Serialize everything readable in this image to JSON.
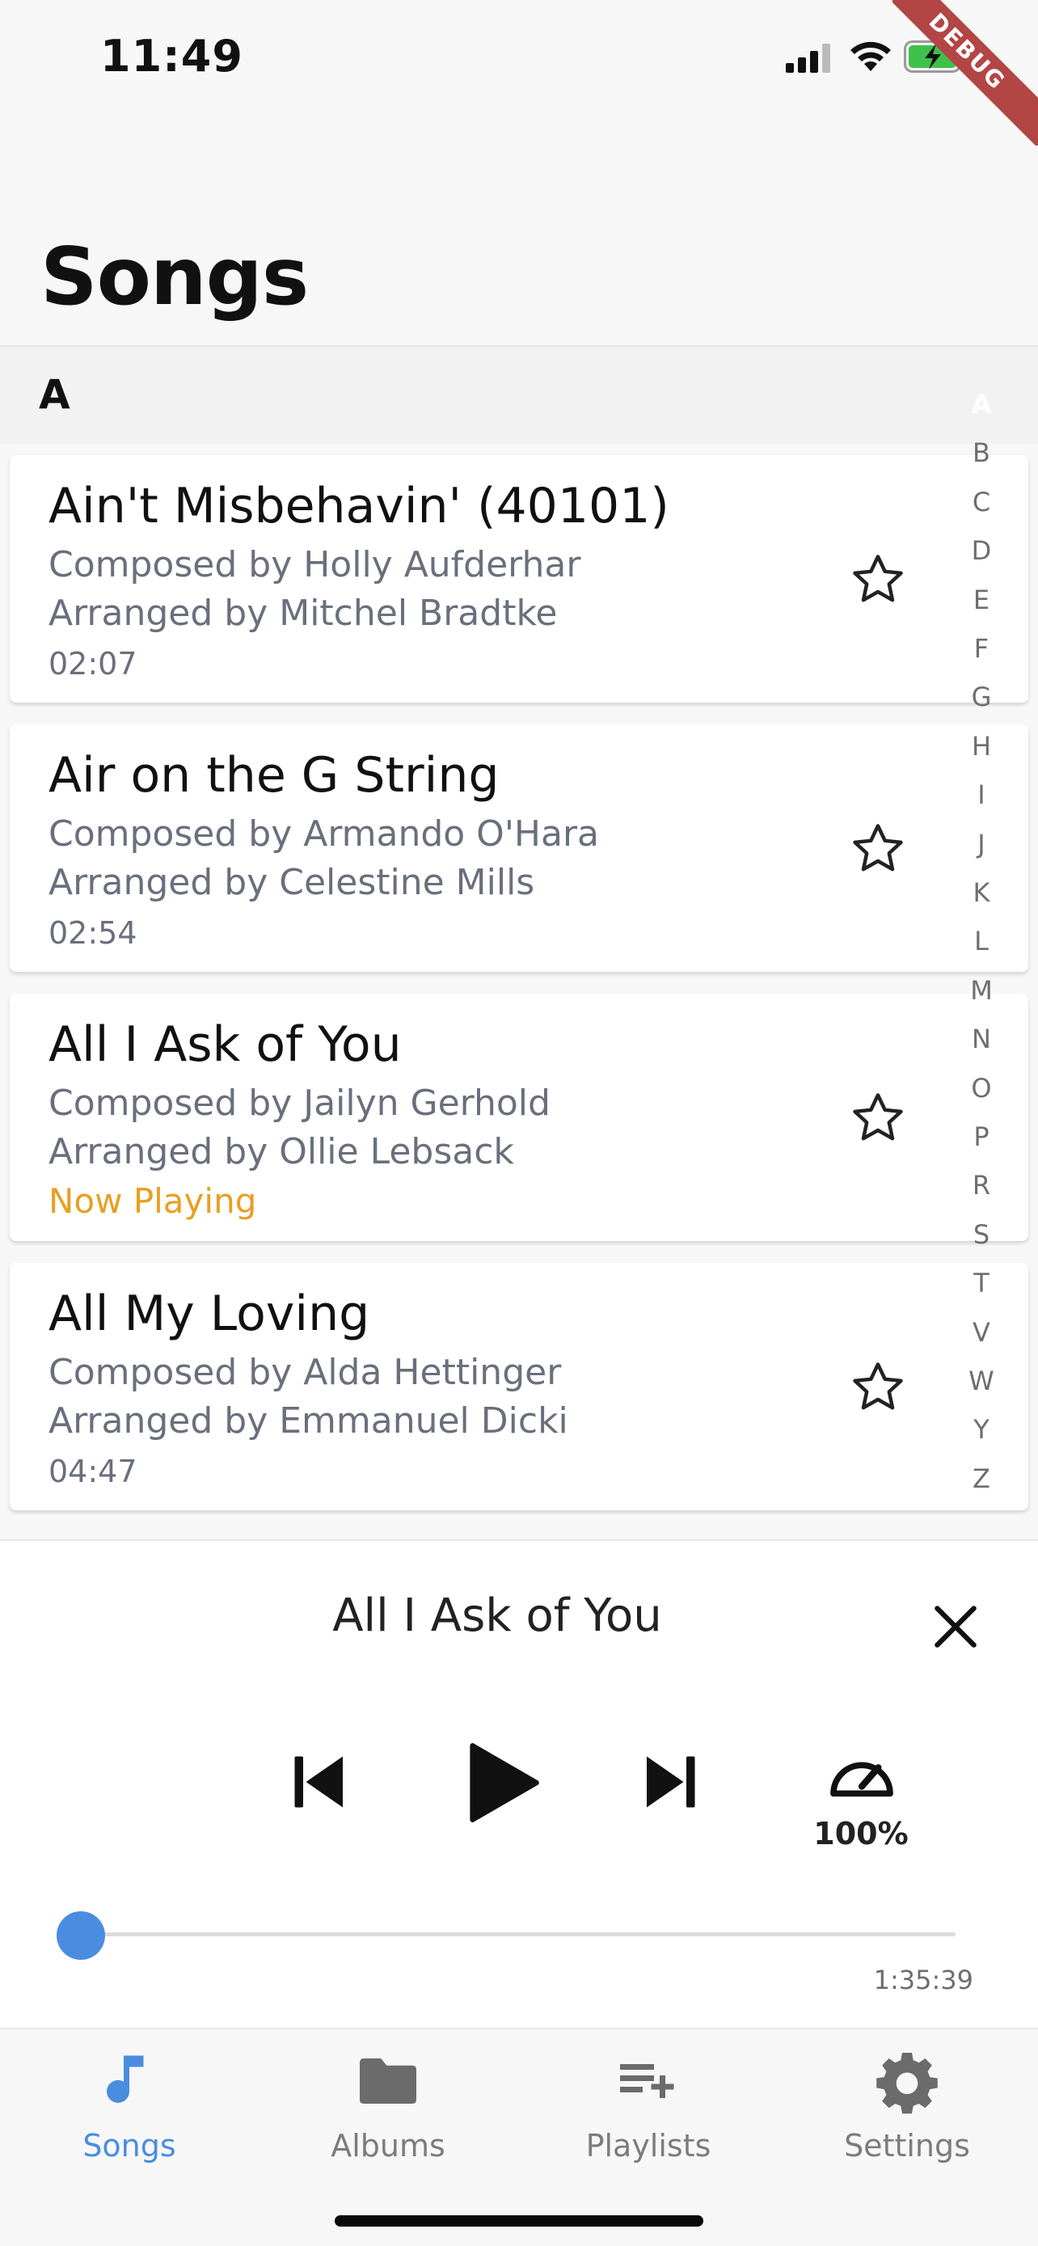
{
  "status_bar": {
    "time": "11:49",
    "debug_banner": "DEBUG",
    "icons": [
      "signal-icon",
      "wifi-icon",
      "battery-charging-icon"
    ],
    "battery_color": "#3ec14a"
  },
  "page": {
    "title": "Songs"
  },
  "section": {
    "letter": "A"
  },
  "songs": [
    {
      "title": "Ain't Misbehavin' (40101)",
      "composer": "Composed by Holly Aufderhar",
      "arranger": "Arranged by Mitchel Bradtke",
      "meta": "02:07",
      "starred": false
    },
    {
      "title": "Air on the G String",
      "composer": "Composed by Armando O'Hara",
      "arranger": "Arranged by Celestine Mills",
      "meta": "02:54",
      "starred": false
    },
    {
      "title": "All I Ask of You",
      "composer": "Composed by Jailyn Gerhold",
      "arranger": "Arranged by Ollie Lebsack",
      "meta": "Now Playing",
      "starred": false
    },
    {
      "title": "All My Loving",
      "composer": "Composed by Alda Hettinger",
      "arranger": "Arranged by Emmanuel Dicki",
      "meta": "04:47",
      "starred": false
    }
  ],
  "alphabet_index": {
    "active": "A",
    "letters": [
      "A",
      "B",
      "C",
      "D",
      "E",
      "F",
      "G",
      "H",
      "I",
      "J",
      "K",
      "L",
      "M",
      "N",
      "O",
      "P",
      "R",
      "S",
      "T",
      "V",
      "W",
      "Y",
      "Z"
    ]
  },
  "player": {
    "title": "All I Ask of You",
    "speed": "100%",
    "duration": "1:35:39",
    "progress": 0.003,
    "accent": "#4a8de0"
  },
  "tabs": [
    {
      "label": "Songs",
      "icon": "music-note-icon",
      "active": true
    },
    {
      "label": "Albums",
      "icon": "folder-icon",
      "active": false
    },
    {
      "label": "Playlists",
      "icon": "playlist-add-icon",
      "active": false
    },
    {
      "label": "Settings",
      "icon": "gear-icon",
      "active": false
    }
  ],
  "colors": {
    "accent": "#4a8de0",
    "now_playing": "#e7a021",
    "secondary_text": "#6a6f7d",
    "debug_ribbon": "#b34545"
  }
}
